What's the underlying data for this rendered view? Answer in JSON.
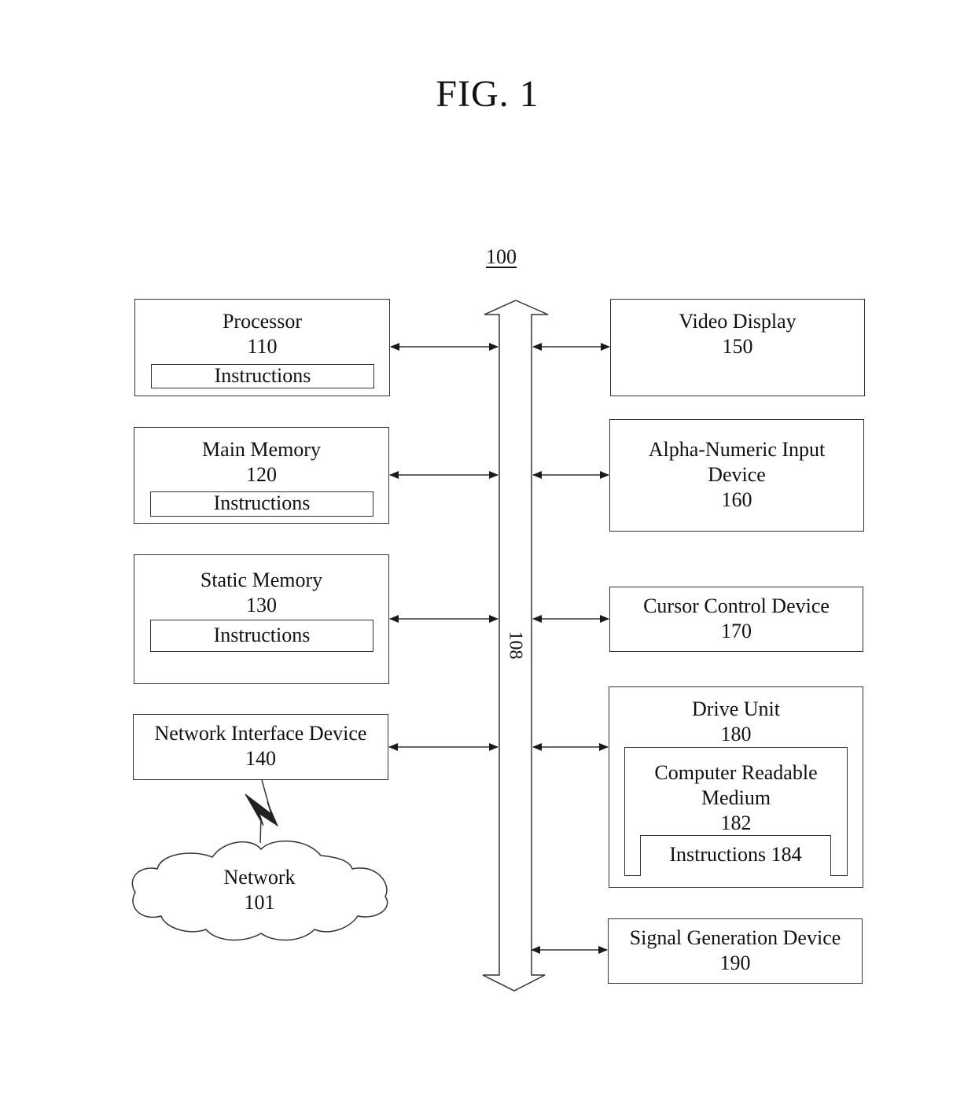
{
  "figure": {
    "title": "FIG. 1",
    "system_ref": "100",
    "bus": {
      "label": "108"
    }
  },
  "left_components": [
    {
      "name": "Processor",
      "ref": "110",
      "inner": "Instructions"
    },
    {
      "name": "Main Memory",
      "ref": "120",
      "inner": "Instructions"
    },
    {
      "name": "Static Memory",
      "ref": "130",
      "inner": "Instructions"
    },
    {
      "name": "Network Interface Device",
      "ref": "140"
    }
  ],
  "right_components": [
    {
      "name": "Video Display",
      "ref": "150"
    },
    {
      "name_line1": "Alpha-Numeric Input",
      "name_line2": "Device",
      "ref": "160"
    },
    {
      "name": "Cursor Control Device",
      "ref": "170"
    },
    {
      "name": "Drive Unit",
      "ref": "180",
      "medium": {
        "line1": "Computer Readable",
        "line2": "Medium",
        "ref": "182",
        "instructions": "Instructions 184"
      }
    },
    {
      "name": "Signal Generation Device",
      "ref": "190"
    }
  ],
  "network": {
    "name": "Network",
    "ref": "101"
  },
  "colors": {
    "line": "#333333",
    "arrow": "#1a1a1a",
    "background": "#ffffff"
  }
}
